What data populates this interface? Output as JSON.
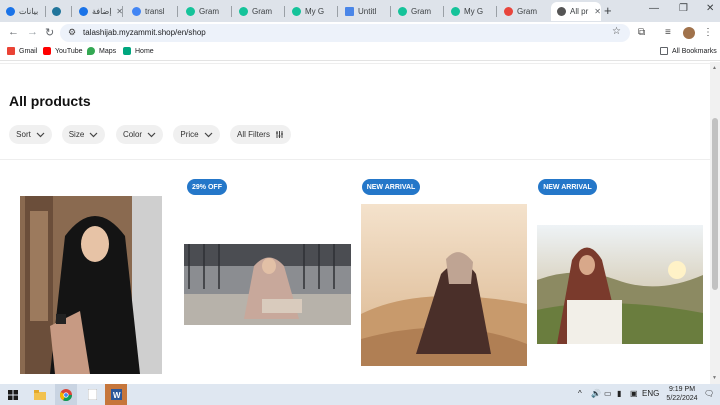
{
  "tabs": [
    {
      "label": "بيانات",
      "color": "#1a73e8"
    },
    {
      "label": "WordPress",
      "color": "#21759b"
    },
    {
      "label": "إضافة",
      "color": "#1a73e8"
    },
    {
      "label": "transl",
      "color": "#4285f4"
    },
    {
      "label": "Gram",
      "color": "#15c39a"
    },
    {
      "label": "Gram",
      "color": "#15c39a"
    },
    {
      "label": "My G",
      "color": "#15c39a"
    },
    {
      "label": "Untitl",
      "color": "#4a86e8"
    },
    {
      "label": "Gram",
      "color": "#15c39a"
    },
    {
      "label": "My G",
      "color": "#15c39a"
    },
    {
      "label": "Gram",
      "color": "#e8453c"
    },
    {
      "label": "All pr",
      "color": "#555555"
    }
  ],
  "url": "talashijab.myzammit.shop/en/shop",
  "bookmarks": [
    {
      "label": "Gmail",
      "color": "#ea4335"
    },
    {
      "label": "YouTube",
      "color": "#ff0000"
    },
    {
      "label": "Maps",
      "color": "#34a853"
    },
    {
      "label": "Home",
      "color": "#00a67e"
    }
  ],
  "all_bookmarks": "All Bookmarks",
  "page_title": "All products",
  "filters": [
    {
      "label": "Sort",
      "icon": "chevron-down-icon"
    },
    {
      "label": "Size",
      "icon": "chevron-down-icon"
    },
    {
      "label": "Color",
      "icon": "chevron-down-icon"
    },
    {
      "label": "Price",
      "icon": "chevron-down-icon"
    },
    {
      "label": "All Filters",
      "icon": "sliders-icon"
    }
  ],
  "products": [
    {
      "badge": null
    },
    {
      "badge": "29% OFF"
    },
    {
      "badge": "NEW ARRIVAL"
    },
    {
      "badge": "NEW ARRIVAL"
    }
  ],
  "clock": {
    "time": "9:19 PM",
    "date": "5/22/2024"
  },
  "tray_lang": "ENG",
  "colors": {
    "badge": "#2477c9",
    "filter_bg": "#f0f0f0",
    "tab_strip": "#dee3ea"
  }
}
